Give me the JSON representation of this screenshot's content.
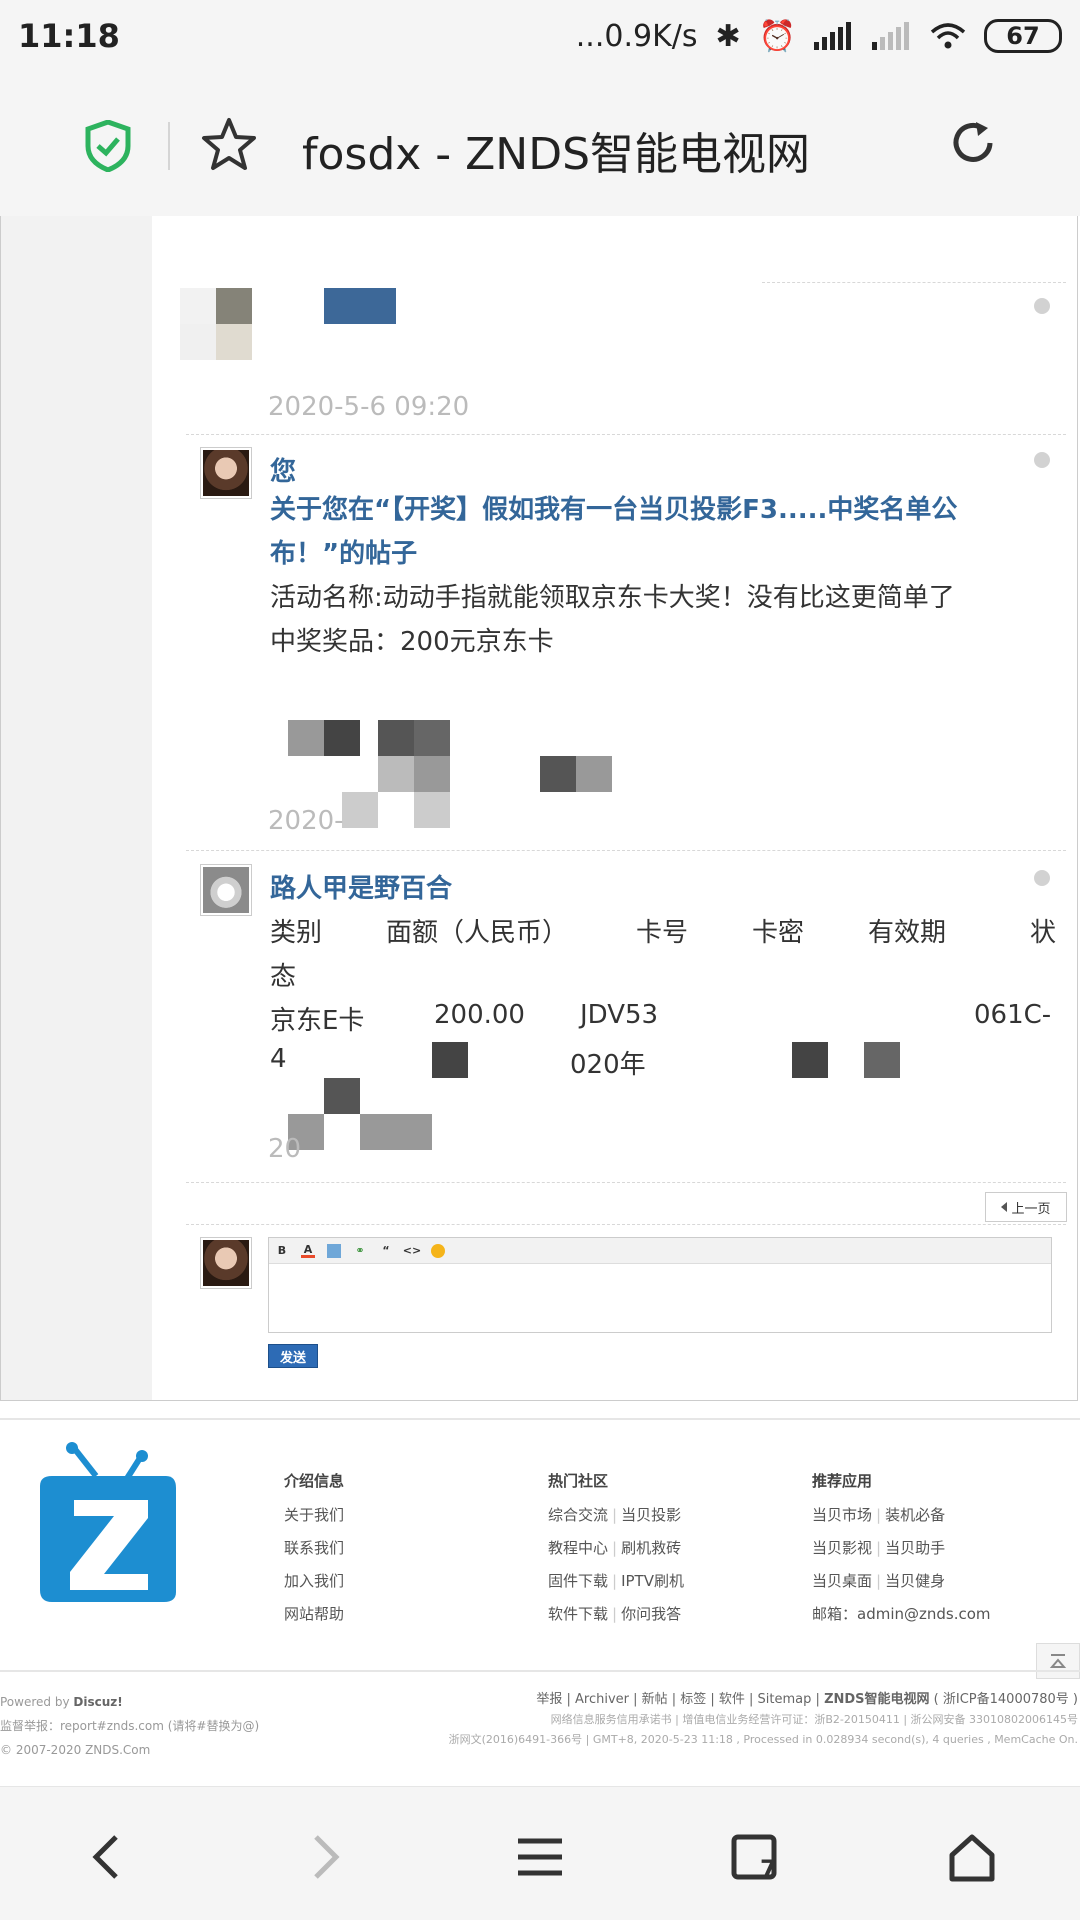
{
  "status_bar": {
    "time": "11:18",
    "network_speed": "...0.9K/s",
    "battery": "67"
  },
  "browser": {
    "page_title": "fosdx - ZNDS智能电视网"
  },
  "posts": [
    {
      "date_faded": "2020-5-6 09:20"
    },
    {
      "author": "您",
      "title": "关于您在“【开奖】假如我有一台当贝投影F3.....中奖名单公布！”的帖子",
      "line1": "活动名称:动动手指就能领取京东卡大奖！没有比这更简单了",
      "line2": "中奖奖品：200元京东卡",
      "date_faded": "2020-"
    },
    {
      "author": "路人甲是野百合",
      "headers": [
        "类别",
        "面额（人民币）",
        "卡号",
        "卡密",
        "有效期",
        "状"
      ],
      "header_wrap": "态",
      "row_card": "京东E卡",
      "row_amount": "200.00",
      "row_number": "JDV53",
      "row_tail": "061C-",
      "row2_start": "4",
      "row2_year": "020年",
      "date_faded": "20"
    }
  ],
  "pagination": {
    "prev_label": "上一页"
  },
  "reply": {
    "send_label": "发送"
  },
  "footer": {
    "columns": [
      {
        "heading": "介绍信息",
        "rows": [
          "关于我们",
          "联系我们",
          "加入我们",
          "网站帮助"
        ]
      },
      {
        "heading": "热门社区",
        "rows": [
          [
            "综合交流",
            "当贝投影"
          ],
          [
            "教程中心",
            "刷机救砖"
          ],
          [
            "固件下载",
            "IPTV刷机"
          ],
          [
            "软件下载",
            "你问我答"
          ]
        ]
      },
      {
        "heading": "推荐应用",
        "rows": [
          [
            "当贝市场",
            "装机必备"
          ],
          [
            "当贝影视",
            "当贝助手"
          ],
          [
            "当贝桌面",
            "当贝健身"
          ]
        ],
        "email": "邮箱：admin@znds.com"
      }
    ],
    "powered_prefix": "Powered by",
    "powered_name": "Discuz!",
    "report": "监督举报：report#znds.com (请将#替换为@)",
    "copyright_prefix": "© 2007-2020",
    "copyright_site": "ZNDS.Com",
    "links": "举报 | Archiver | 新帖 | 标签 | 软件 | Sitemap |",
    "site_name": "ZNDS智能电视网",
    "icp": "( 浙ICP备14000780号 )",
    "license": "网络信息服务信用承诺书 | 增值电信业务经营许可证：浙B2-20150411 | 浙公网安备 33010802006145号",
    "stats": "浙网文(2016)6491-366号 | GMT+8, 2020-5-23 11:18 , Processed in 0.028934 second(s), 4 queries , MemCache On."
  }
}
